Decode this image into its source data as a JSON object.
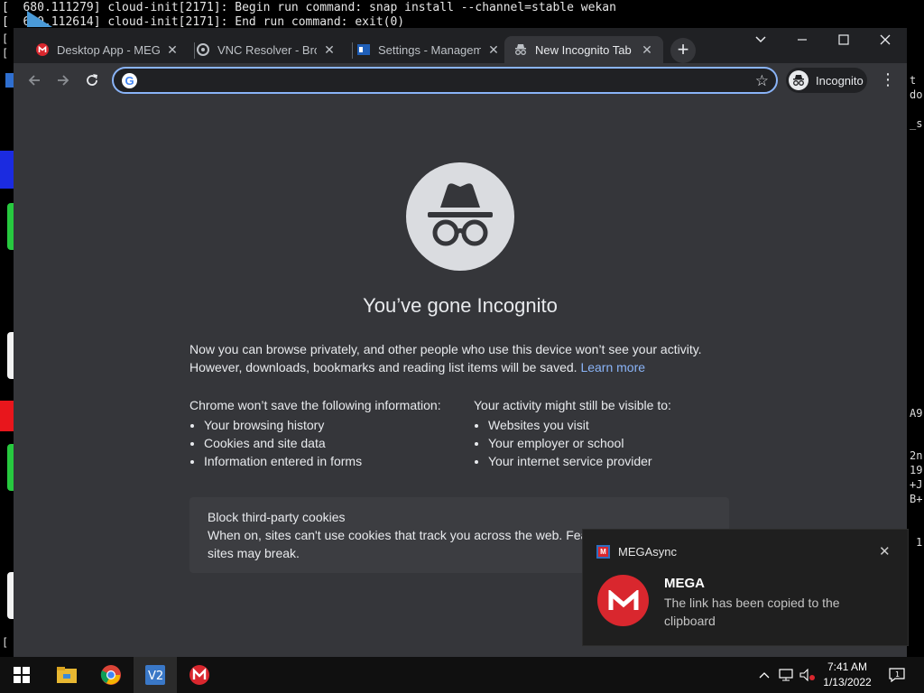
{
  "terminal": {
    "line1": "[  680.111279] cloud-init[2171]: Begin run command: snap install --channel=stable wekan",
    "line2": "[  680.112614] cloud-init[2171]: End run command: exit(0)",
    "right_fragments": [
      "t",
      "do",
      "_s",
      "A9",
      "2n",
      "19",
      "+J",
      "B+",
      "1"
    ]
  },
  "browser": {
    "tabs": [
      {
        "title": "Desktop App - MEGA",
        "icon": "mega-icon"
      },
      {
        "title": "VNC Resolver - Brows",
        "icon": "vnc-icon"
      },
      {
        "title": "Settings - Manageme",
        "icon": "settings-icon"
      },
      {
        "title": "New Incognito Tab",
        "icon": "incognito-icon",
        "active": true
      }
    ],
    "new_tab_label": "+",
    "omnibox": {
      "value": "",
      "placeholder": ""
    },
    "profile_label": "Incognito"
  },
  "page": {
    "title": "You’ve gone Incognito",
    "intro_line1": "Now you can browse privately, and other people who use this device won’t see your activity.",
    "intro_line2": "However, downloads, bookmarks and reading list items will be saved.",
    "learn_more": "Learn more",
    "not_saved_heading": "Chrome won’t save the following information:",
    "not_saved_items": [
      "Your browsing history",
      "Cookies and site data",
      "Information entered in forms"
    ],
    "visible_heading": "Your activity might still be visible to:",
    "visible_items": [
      "Websites you visit",
      "Your employer or school",
      "Your internet service provider"
    ],
    "cookie_title": "Block third-party cookies",
    "cookie_body": "When on, sites can't use cookies that track you across the web. Fea",
    "cookie_body2": "sites may break."
  },
  "toast": {
    "app_name": "MEGAsync",
    "title": "MEGA",
    "message": "The link has been copied to the clipboard"
  },
  "taskbar": {
    "time": "7:41 AM",
    "date": "1/13/2022"
  },
  "colors": {
    "accent": "#8ab4f8",
    "mega_red": "#d9272e",
    "incognito_bg": "#35363a"
  }
}
